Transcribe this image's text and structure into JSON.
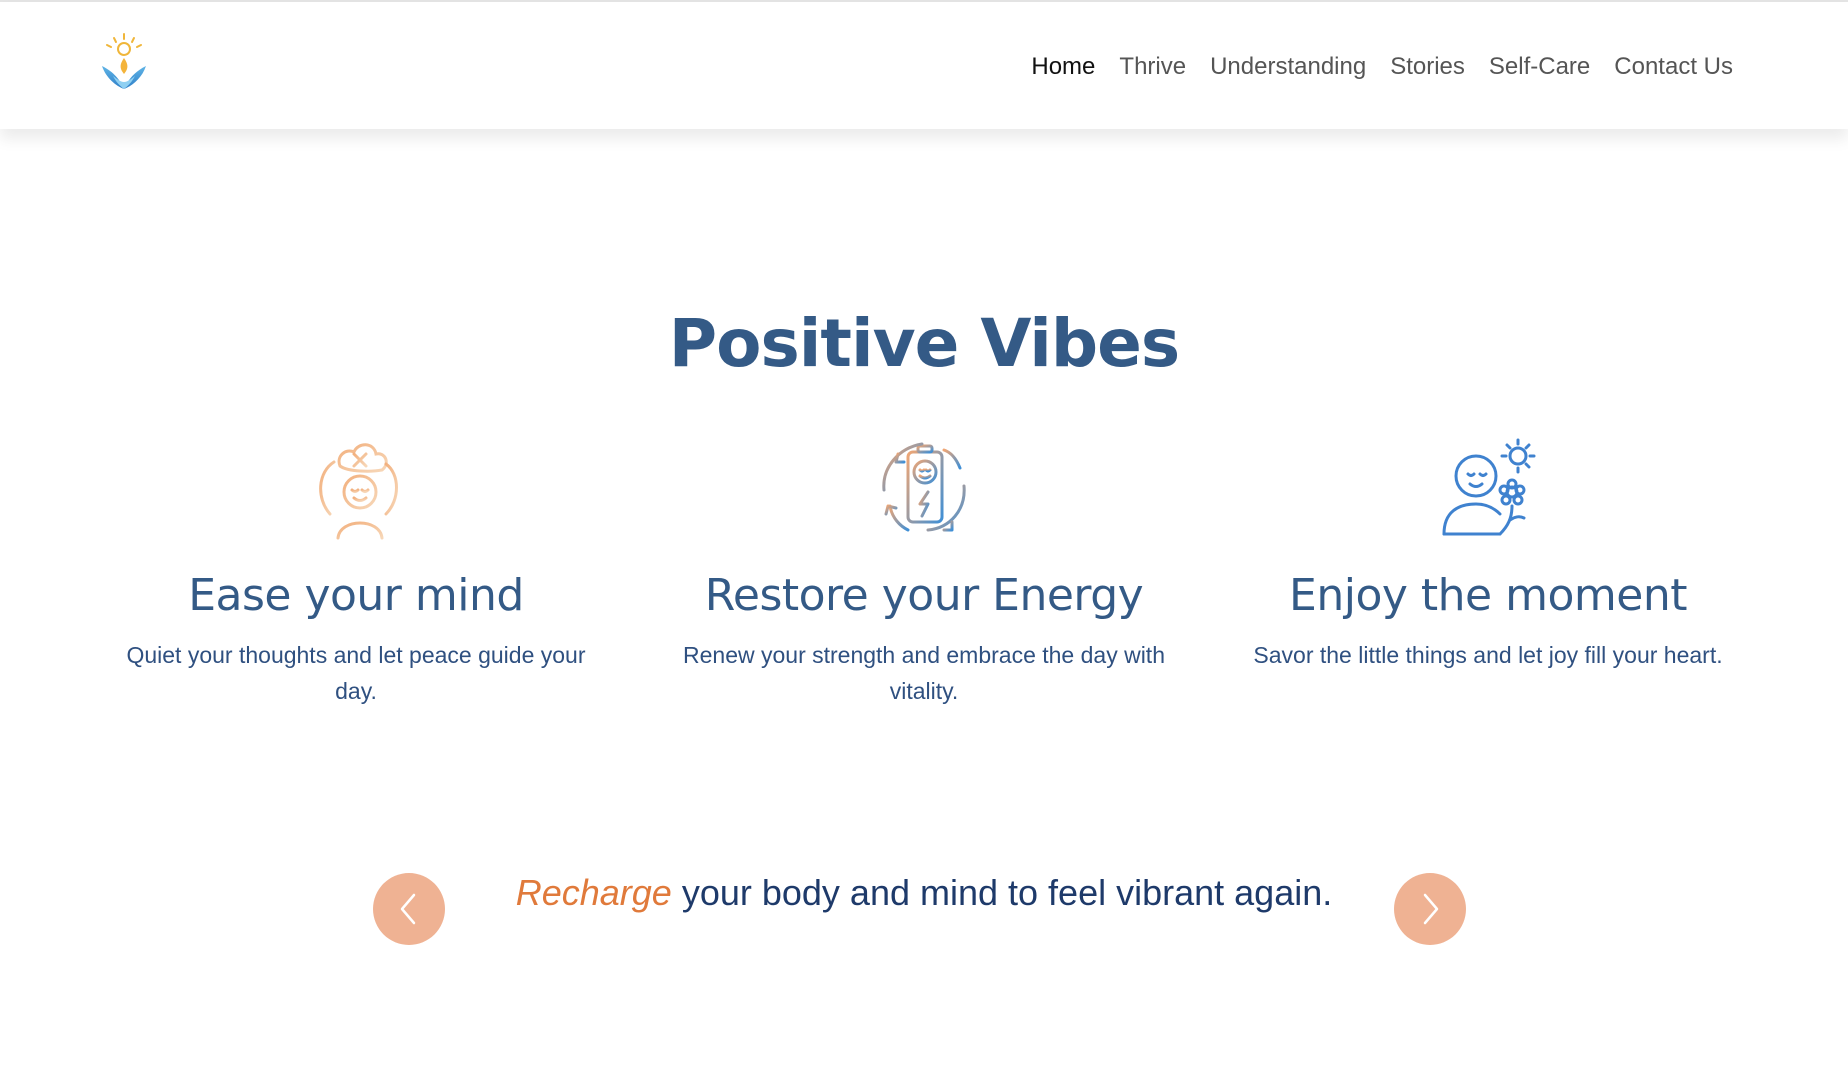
{
  "nav": {
    "items": [
      {
        "label": "Home",
        "active": true
      },
      {
        "label": "Thrive"
      },
      {
        "label": "Understanding"
      },
      {
        "label": "Stories"
      },
      {
        "label": "Self-Care"
      },
      {
        "label": "Contact Us"
      }
    ]
  },
  "main": {
    "title": "Positive Vibes",
    "cards": [
      {
        "icon": "calm-mind-icon",
        "heading": "Ease your mind",
        "text": "Quiet your thoughts and let peace guide your day."
      },
      {
        "icon": "battery-energy-icon",
        "heading": "Restore your Energy",
        "text": "Renew your strength and embrace the day with vitality."
      },
      {
        "icon": "happy-person-sun-icon",
        "heading": "Enjoy the moment",
        "text": "Savor the little things and let joy fill your heart."
      }
    ]
  },
  "slider": {
    "accent": "Recharge",
    "rest": " your body and mind to feel vibrant again.",
    "prev_icon": "chevron-left-icon",
    "next_icon": "chevron-right-icon"
  },
  "colors": {
    "heading": "#345a86",
    "accent": "#e07a3b",
    "arrow_bg": "#efb293"
  }
}
